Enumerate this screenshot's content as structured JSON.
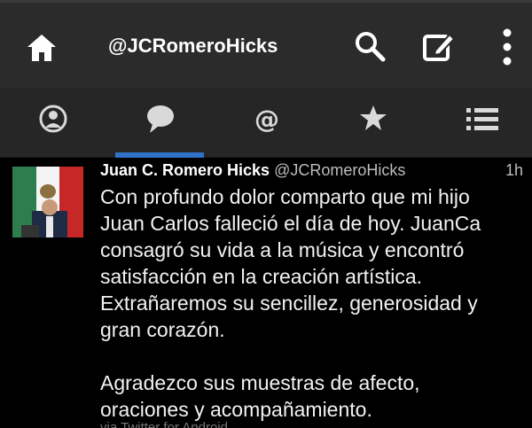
{
  "header": {
    "handle": "@JCRomeroHicks",
    "icons": [
      "home-icon",
      "search-icon",
      "compose-icon",
      "more-vert-icon"
    ]
  },
  "tabs": [
    {
      "name": "profile",
      "icon": "person-icon",
      "active": false
    },
    {
      "name": "messages",
      "icon": "speech-bubble-icon",
      "active": true
    },
    {
      "name": "mentions",
      "icon": "at-icon",
      "active": false
    },
    {
      "name": "favorites",
      "icon": "star-icon",
      "active": false
    },
    {
      "name": "lists",
      "icon": "list-icon",
      "active": false
    }
  ],
  "tweet": {
    "name": "Juan C. Romero Hicks",
    "username": "@JCRomeroHicks",
    "time": "1h",
    "lines": [
      "Con profundo dolor comparto que mi hijo",
      "Juan Carlos falleció el día de hoy. JuanCa",
      "consagró su vida a la música y encontró",
      "satisfacción en la creación artística.",
      "Extrañaremos su sencillez, generosidad y",
      "gran corazón."
    ],
    "lines2": [
      "Agradezco sus muestras de afecto,",
      "oraciones y acompañamiento."
    ],
    "via": "via Twitter for Android"
  },
  "colors": {
    "topbar": "#2b2b2b",
    "tabbar": "#262626",
    "accent": "#2f73c8",
    "icon": "#d9d9d9",
    "background": "#000000"
  }
}
